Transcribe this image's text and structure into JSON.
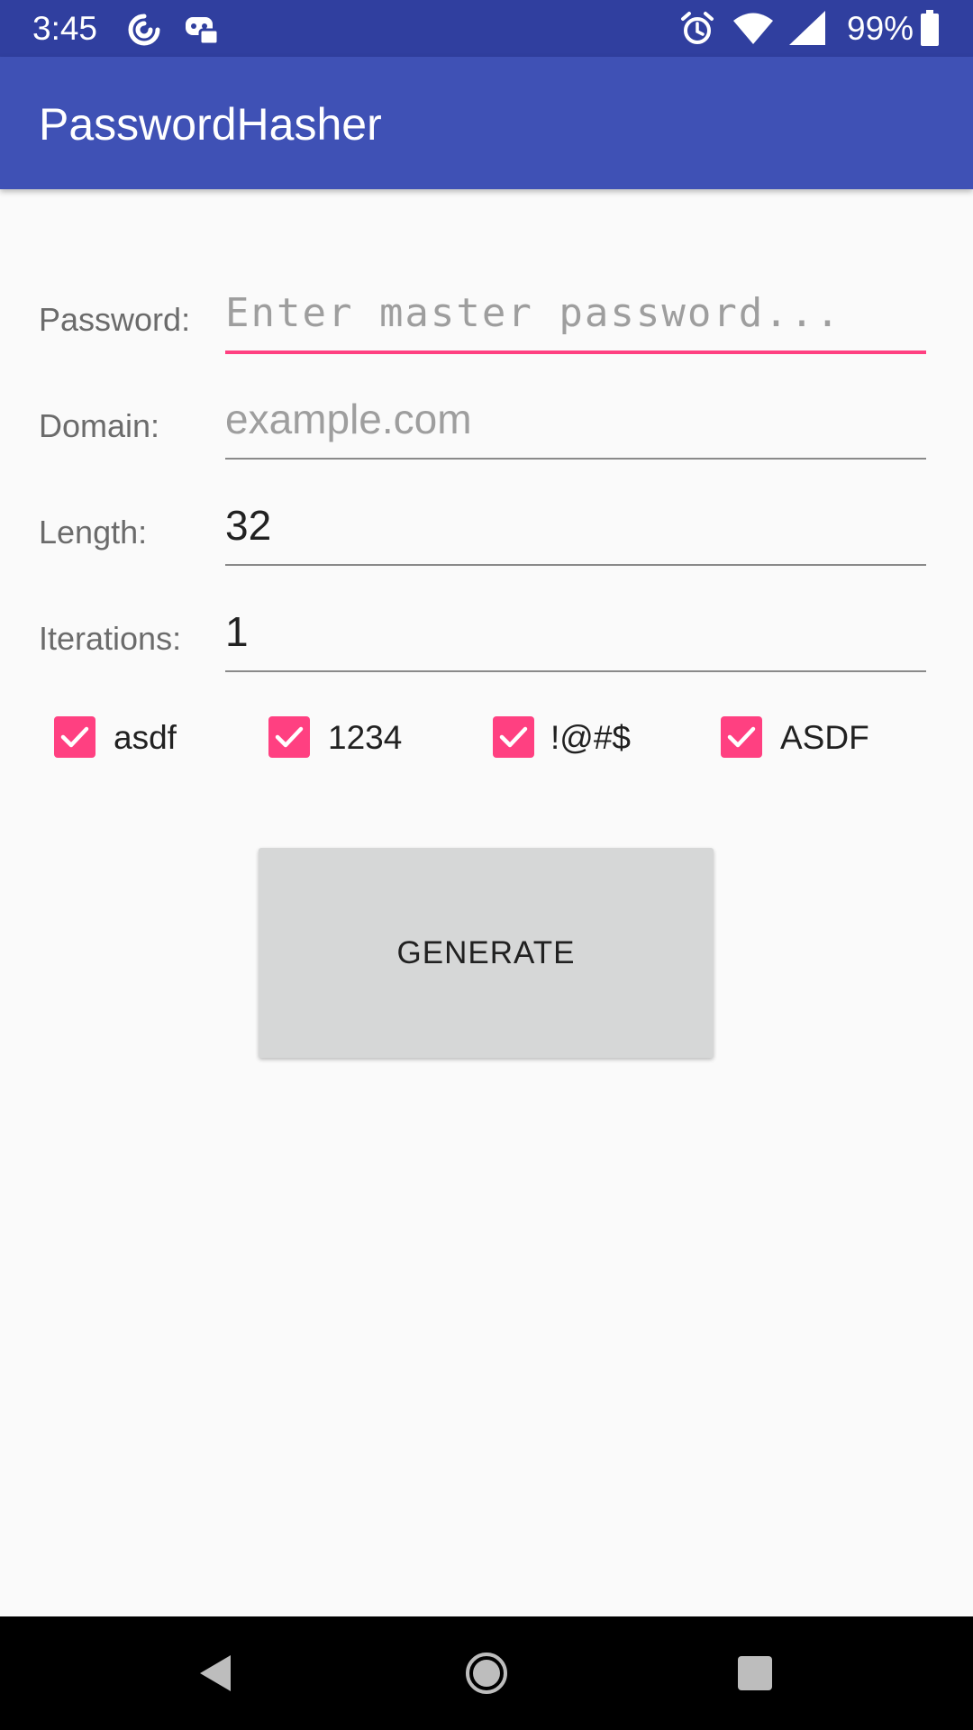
{
  "status_bar": {
    "time": "3:45",
    "battery": "99%",
    "icons": [
      "sync-icon",
      "game-controller-icon",
      "alarm-icon",
      "wifi-icon",
      "cell-signal-icon",
      "battery-icon"
    ]
  },
  "app_bar": {
    "title": "PasswordHasher"
  },
  "form": {
    "password": {
      "label": "Password:",
      "value": "",
      "placeholder": "Enter master password..."
    },
    "domain": {
      "label": "Domain:",
      "value": "",
      "placeholder": "example.com"
    },
    "length": {
      "label": "Length:",
      "value": "32",
      "placeholder": ""
    },
    "iterations": {
      "label": "Iterations:",
      "value": "1",
      "placeholder": ""
    }
  },
  "options": [
    {
      "label": "asdf",
      "checked": true
    },
    {
      "label": "1234",
      "checked": true
    },
    {
      "label": "!@#$",
      "checked": true
    },
    {
      "label": "ASDF",
      "checked": true
    }
  ],
  "actions": {
    "generate_label": "GENERATE"
  },
  "nav_bar": {
    "icons": [
      "back-icon",
      "home-icon",
      "recents-icon"
    ]
  },
  "colors": {
    "status_bar": "#303f9f",
    "app_bar": "#3f51b5",
    "accent": "#ff4081",
    "background": "#fafafa",
    "button": "#d6d7d7"
  }
}
